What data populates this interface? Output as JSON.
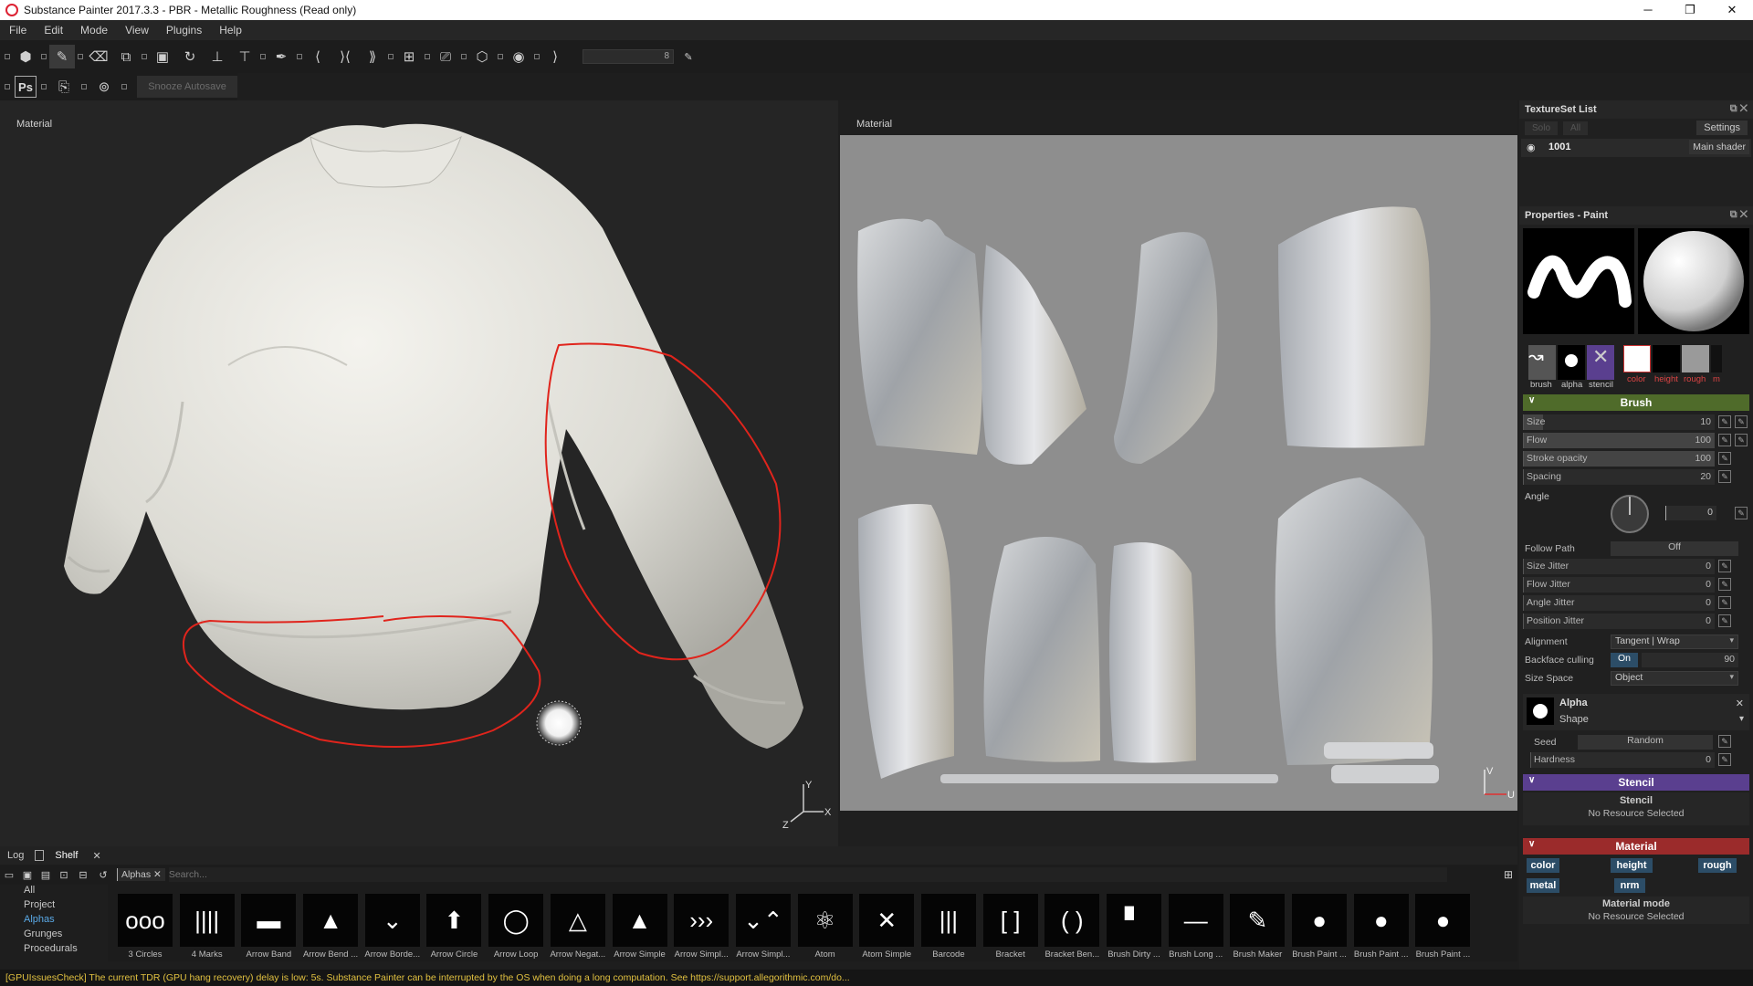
{
  "window": {
    "title": "Substance Painter 2017.3.3 - PBR - Metallic Roughness (Read only)",
    "controls": [
      "─",
      "❐",
      "✕"
    ]
  },
  "menu": [
    "File",
    "Edit",
    "Mode",
    "View",
    "Plugins",
    "Help"
  ],
  "toolbar": {
    "brush_size_value": "8",
    "snooze_label": "Snooze Autosave",
    "ps_label": "Ps"
  },
  "viewport3d": {
    "label": "Material",
    "axes": {
      "x": "X",
      "y": "Y",
      "z": "Z"
    }
  },
  "viewport2d": {
    "label": "Material",
    "axes": {
      "u": "U",
      "v": "V"
    }
  },
  "texture_set_list": {
    "title": "TextureSet List",
    "solo_label": "Solo",
    "all_label": "All",
    "settings_label": "Settings",
    "items": [
      {
        "name": "1001",
        "shader": "Main shader"
      }
    ]
  },
  "properties": {
    "title": "Properties - Paint",
    "channels": {
      "brush": "brush",
      "alpha": "alpha",
      "stencil": "stencil",
      "color": "color",
      "height": "height",
      "rough": "rough",
      "metal": "m"
    },
    "brush_section": "Brush",
    "size": {
      "label": "Size",
      "value": "10",
      "fraction": 0.1
    },
    "flow": {
      "label": "Flow",
      "value": "100"
    },
    "stroke_opacity": {
      "label": "Stroke opacity",
      "value": "100"
    },
    "spacing": {
      "label": "Spacing",
      "value": "20"
    },
    "angle": {
      "label": "Angle",
      "value": "0"
    },
    "follow_path": {
      "label": "Follow Path",
      "value": "Off"
    },
    "size_jitter": {
      "label": "Size Jitter",
      "value": "0"
    },
    "flow_jitter": {
      "label": "Flow Jitter",
      "value": "0"
    },
    "angle_jitter": {
      "label": "Angle Jitter",
      "value": "0"
    },
    "position_jitter": {
      "label": "Position Jitter",
      "value": "0"
    },
    "alignment": {
      "label": "Alignment",
      "value": "Tangent | Wrap"
    },
    "backface_culling": {
      "label": "Backface culling",
      "toggle": "On",
      "value": "90"
    },
    "size_space": {
      "label": "Size Space",
      "value": "Object"
    },
    "alpha": {
      "title": "Alpha",
      "subtitle": "Shape"
    },
    "seed": {
      "label": "Seed",
      "value": "Random"
    },
    "hardness": {
      "label": "Hardness",
      "value": "0"
    },
    "stencil_section": "Stencil",
    "stencil": {
      "title": "Stencil",
      "value": "No Resource Selected"
    },
    "material_section": "Material",
    "material_chips": {
      "color": "color",
      "height": "height",
      "rough": "rough",
      "metal": "metal",
      "nrm": "nrm"
    },
    "material_mode": {
      "title": "Material mode",
      "value": "No Resource Selected"
    },
    "accent": {
      "brush": "#4f6b2a",
      "stencil": "#5a3f8f",
      "material": "#9b2b2b",
      "chip": "#2c4d67"
    }
  },
  "shelf": {
    "tabs": [
      "Log",
      "Shelf"
    ],
    "filter_tag": "Alphas",
    "search_placeholder": "Search...",
    "categories": [
      "All",
      "Project",
      "Alphas",
      "Grunges",
      "Procedurals"
    ],
    "items": [
      {
        "name": "3 Circles",
        "glyph": "ooo"
      },
      {
        "name": "4 Marks",
        "glyph": "||||"
      },
      {
        "name": "Arrow Band",
        "glyph": "▬"
      },
      {
        "name": "Arrow Bend ...",
        "glyph": "▲"
      },
      {
        "name": "Arrow Borde...",
        "glyph": "⌄"
      },
      {
        "name": "Arrow Circle",
        "glyph": "⬆"
      },
      {
        "name": "Arrow Loop",
        "glyph": "◯"
      },
      {
        "name": "Arrow Negat...",
        "glyph": "△"
      },
      {
        "name": "Arrow Simple",
        "glyph": "▲"
      },
      {
        "name": "Arrow Simpl...",
        "glyph": "›››"
      },
      {
        "name": "Arrow Simpl...",
        "glyph": "⌄⌃"
      },
      {
        "name": "Atom",
        "glyph": "⚛"
      },
      {
        "name": "Atom Simple",
        "glyph": "✕"
      },
      {
        "name": "Barcode",
        "glyph": "|||"
      },
      {
        "name": "Bracket",
        "glyph": "[ ]"
      },
      {
        "name": "Bracket Ben...",
        "glyph": "( )"
      },
      {
        "name": "Brush Dirty ...",
        "glyph": "▘"
      },
      {
        "name": "Brush Long ...",
        "glyph": "—"
      },
      {
        "name": "Brush Maker",
        "glyph": "✎"
      },
      {
        "name": "Brush Paint ...",
        "glyph": "●"
      },
      {
        "name": "Brush Paint ...",
        "glyph": "●"
      },
      {
        "name": "Brush Paint ...",
        "glyph": "●"
      }
    ]
  },
  "status": "[GPUIssuesCheck] The current TDR (GPU hang recovery) delay is low: 5s. Substance Painter can be interrupted by the OS when doing a long computation. See https://support.allegorithmic.com/do..."
}
